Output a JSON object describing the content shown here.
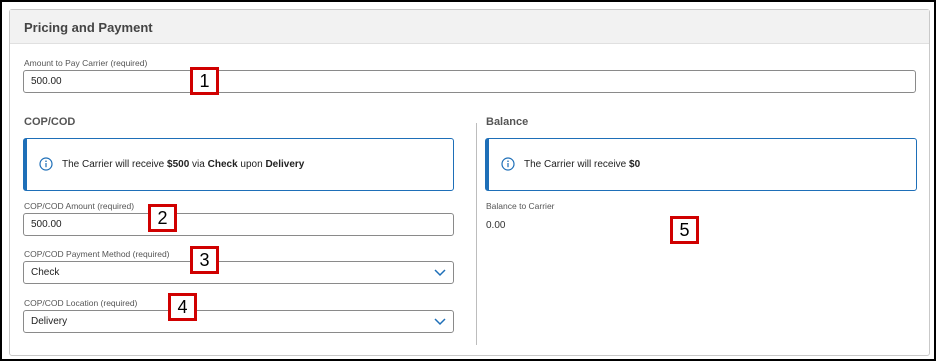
{
  "panel": {
    "title": "Pricing and Payment"
  },
  "amount_to_pay": {
    "label": "Amount to Pay Carrier (required)",
    "value": "500.00"
  },
  "cop_cod": {
    "title": "COP/COD",
    "info": {
      "prefix": "The Carrier will receive ",
      "amount": "$500",
      "mid1": " via ",
      "method": "Check",
      "mid2": " upon ",
      "location": "Delivery"
    },
    "amount": {
      "label": "COP/COD Amount (required)",
      "value": "500.00"
    },
    "payment_method": {
      "label": "COP/COD Payment Method (required)",
      "selected": "Check"
    },
    "location": {
      "label": "COP/COD Location (required)",
      "selected": "Delivery"
    }
  },
  "balance": {
    "title": "Balance",
    "info": {
      "prefix": "The Carrier will receive ",
      "amount": "$0"
    },
    "label": "Balance to Carrier",
    "value": "0.00"
  },
  "callouts": [
    "1",
    "2",
    "3",
    "4",
    "5"
  ],
  "colors": {
    "accent": "#1e6fb8",
    "callout_border": "#d00000"
  }
}
